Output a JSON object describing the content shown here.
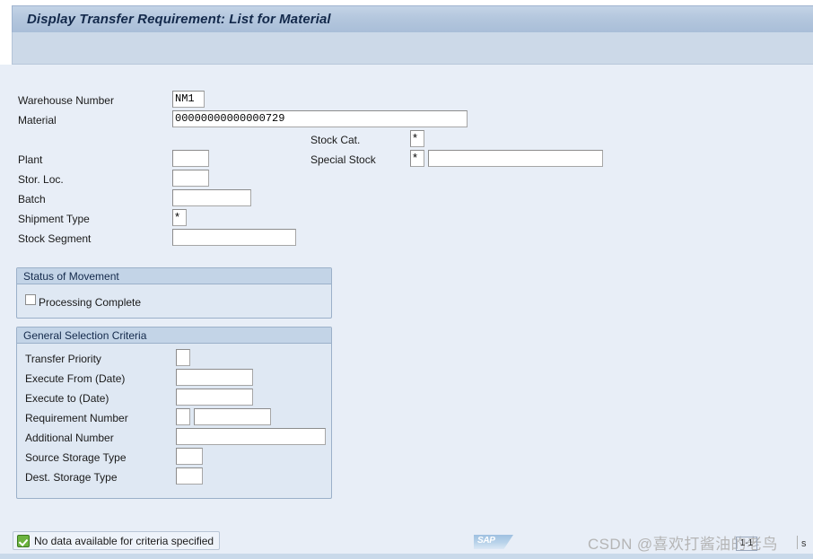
{
  "window": {
    "title": "Display Transfer Requirement: List for Material"
  },
  "selection_screen": {
    "fields": [
      {
        "label": "Warehouse Number",
        "value": "NM1"
      },
      {
        "label": "Material",
        "value": "00000000000000729"
      },
      {
        "label": "Plant",
        "value": ""
      },
      {
        "label": "Stor. Loc.",
        "value": ""
      },
      {
        "label": "Batch",
        "value": ""
      },
      {
        "label": "Shipment Type",
        "value": "*"
      },
      {
        "label": "Stock Segment",
        "value": ""
      }
    ],
    "right_fields": [
      {
        "label": "Stock Cat.",
        "value": "*"
      },
      {
        "label": "Special Stock",
        "value": "*",
        "extra_value": ""
      }
    ]
  },
  "status_of_movement": {
    "title": "Status of Movement",
    "checkbox_label": "Processing Complete",
    "checked": false
  },
  "general_selection_criteria": {
    "title": "General Selection Criteria",
    "rows": [
      {
        "label": "Transfer Priority",
        "value": ""
      },
      {
        "label": "Execute From (Date)",
        "value": ""
      },
      {
        "label": "Execute to (Date)",
        "value": ""
      },
      {
        "label": "Requirement Number",
        "value": "",
        "extra_value": ""
      },
      {
        "label": "Additional Number",
        "value": ""
      },
      {
        "label": "Source Storage Type",
        "value": ""
      },
      {
        "label": "Dest. Storage Type",
        "value": ""
      }
    ]
  },
  "statusbar": {
    "message": "No data available for criteria specified",
    "icon": "success-check-icon",
    "logo_text": "SAP"
  },
  "watermark": {
    "text": "CSDN @喜欢打酱油的老鸟",
    "box_text": "1-1",
    "tail_text": "s"
  },
  "colors": {
    "title_text": "#13294b",
    "page_background": "#e8eef7",
    "group_header": "#c3d4e7",
    "status_green": "#6cb33f"
  }
}
